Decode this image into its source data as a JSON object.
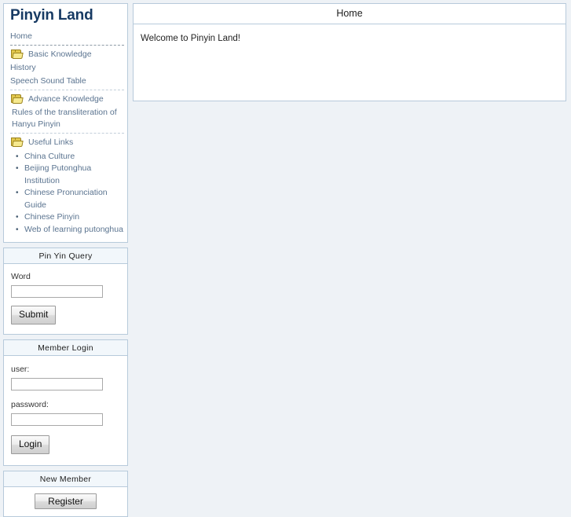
{
  "site": {
    "title": "Pinyin Land"
  },
  "sidebar": {
    "nav": {
      "home_label": "Home",
      "sections": [
        {
          "folder_label": "Basic Knowledge",
          "items": [
            "History",
            "Speech Sound Table"
          ]
        },
        {
          "folder_label": "Advance Knowledge",
          "items": [
            "Rules of the transliteration of Hanyu Pinyin"
          ]
        }
      ],
      "useful_links_label": "Useful Links",
      "useful_links": [
        "China Culture",
        "Beijing Putonghua Institution",
        "Chinese Pronunciation Guide",
        "Chinese Pinyin",
        "Web of learning putonghua"
      ]
    },
    "query_panel": {
      "header": "Pin Yin Query",
      "word_label": "Word",
      "word_value": "",
      "submit_label": "Submit"
    },
    "login_panel": {
      "header": "Member Login",
      "user_label": "user:",
      "user_value": "",
      "password_label": "password:",
      "password_value": "",
      "login_label": "Login"
    },
    "newmember_panel": {
      "header": "New Member",
      "register_label": "Register"
    }
  },
  "main": {
    "header": "Home",
    "body_text": "Welcome to Pinyin Land!"
  }
}
